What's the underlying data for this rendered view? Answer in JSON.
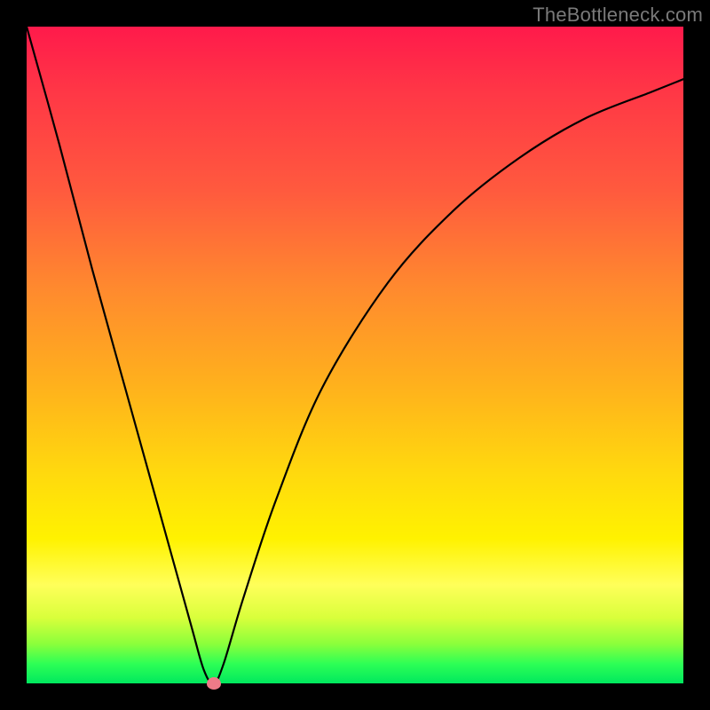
{
  "watermark": "TheBottleneck.com",
  "chart_data": {
    "type": "line",
    "title": "",
    "xlabel": "",
    "ylabel": "",
    "xlim": [
      0,
      100
    ],
    "ylim": [
      0,
      100
    ],
    "grid": false,
    "legend": false,
    "series": [
      {
        "name": "bottleneck-curve",
        "x": [
          0,
          5,
          10,
          15,
          20,
          25,
          27,
          28.5,
          30,
          33,
          38,
          45,
          55,
          65,
          75,
          85,
          95,
          100
        ],
        "y": [
          100,
          82,
          63,
          45,
          27,
          9,
          2,
          0,
          3,
          13,
          28,
          45,
          61,
          72,
          80,
          86,
          90,
          92
        ]
      }
    ],
    "markers": [
      {
        "name": "sweet-spot",
        "x": 28.5,
        "y": 0,
        "color": "#ee7a88"
      }
    ],
    "background_gradient_stops": [
      {
        "pos": 0,
        "color": "#ff1a4b"
      },
      {
        "pos": 25,
        "color": "#ff5a3e"
      },
      {
        "pos": 55,
        "color": "#ffb21c"
      },
      {
        "pos": 78,
        "color": "#fff200"
      },
      {
        "pos": 92,
        "color": "#9bff3b"
      },
      {
        "pos": 100,
        "color": "#00e85e"
      }
    ]
  }
}
